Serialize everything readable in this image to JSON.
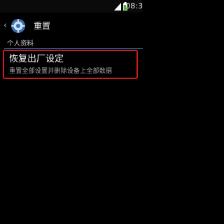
{
  "status_bar": {
    "time": "08:3",
    "icons": [
      "signal-icon",
      "battery-icon"
    ]
  },
  "header": {
    "back_icon": "chevron-left-icon",
    "app_icon": "gear-icon",
    "title": "重置"
  },
  "section": {
    "title": "个人资料"
  },
  "items": [
    {
      "title": "恢复出厂设定",
      "description": "重置全部设置并删除设备上全部数据",
      "highlighted": true
    }
  ],
  "colors": {
    "background": "#000000",
    "divider": "#2a6aa8",
    "highlight_border": "#d41a1a",
    "battery": "#4caf2a"
  }
}
